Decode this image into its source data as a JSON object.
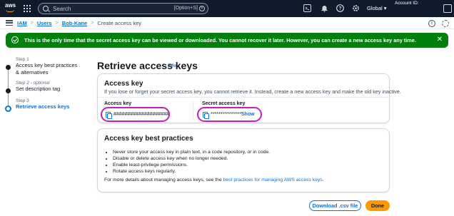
{
  "topnav": {
    "logo_text": "aws",
    "search": {
      "placeholder": "Search",
      "shortcut": "[Option+S]"
    },
    "region": "Global ▾",
    "account_label": "Account ID:"
  },
  "breadcrumb": {
    "items": [
      "IAM",
      "Users",
      "Bob-Kane"
    ],
    "current": "Create access key"
  },
  "flash": {
    "message": "This is the only time that the secret access key can be viewed or downloaded. You cannot recover it later. However, you can create a new access key any time.",
    "type": "success"
  },
  "steps": [
    {
      "num": "Step 1",
      "title": "Access key best practices & alternatives"
    },
    {
      "num": "Step 2 - optional",
      "title": "Set description tag"
    },
    {
      "num": "Step 3",
      "title": "Retrieve access keys"
    }
  ],
  "main": {
    "title": "Retrieve access keys",
    "info": "Info",
    "access_key_card": {
      "heading": "Access key",
      "description": "If you lose or forget your secret access key, you cannot retrieve it. Instead, create a new access key and make the old key inactive.",
      "access_key_label": "Access key",
      "access_key_value": "####################",
      "secret_label": "Secret access key",
      "secret_value": "****************",
      "show_label": "Show"
    },
    "practices_card": {
      "heading": "Access key best practices",
      "bullets": [
        "Never store your access key in plain text, in a code repository, or in code.",
        "Disable or delete access key when no longer needed.",
        "Enable least-privilege permissions.",
        "Rotate access keys regularly."
      ],
      "more_prefix": "For more details about managing access keys, see the ",
      "more_link": "best practices for managing AWS access keys",
      "more_suffix": "."
    }
  },
  "actions": {
    "download": "Download .csv file",
    "done": "Done"
  },
  "colors": {
    "nav_bg": "#0f1b2a",
    "flash_bg": "#037f0c",
    "link": "#0972d3",
    "primary_button": "#ff9900",
    "annotation_oval": "#c71eb6"
  }
}
